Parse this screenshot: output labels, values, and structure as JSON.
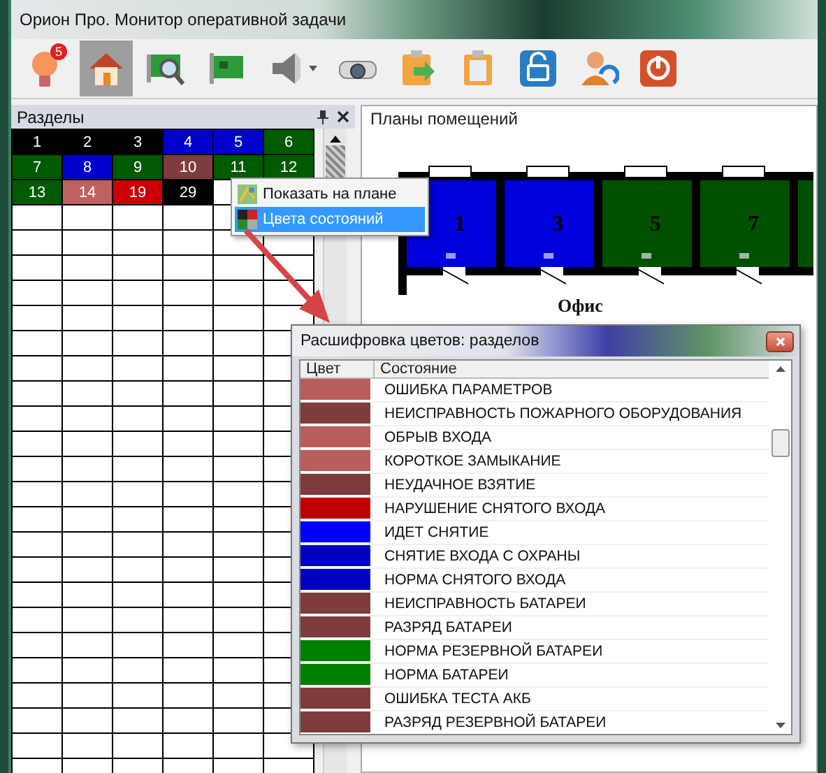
{
  "window": {
    "title": "Орион Про. Монитор оперативной задачи"
  },
  "toolbar": [
    {
      "selected": false,
      "dropdown": false,
      "badge": "5"
    },
    {
      "selected": true,
      "dropdown": false
    },
    {
      "selected": false,
      "dropdown": false
    },
    {
      "selected": false,
      "dropdown": false
    },
    {
      "selected": false,
      "dropdown": true
    },
    {
      "selected": false,
      "dropdown": false
    },
    {
      "selected": false,
      "dropdown": false
    },
    {
      "selected": false,
      "dropdown": false
    },
    {
      "selected": false,
      "dropdown": false
    },
    {
      "selected": false,
      "dropdown": false
    },
    {
      "selected": false,
      "dropdown": false
    }
  ],
  "sections_panel": {
    "title": "Разделы",
    "cells": [
      {
        "text": "1",
        "color": "#000000"
      },
      {
        "text": "2",
        "color": "#000000"
      },
      {
        "text": "3",
        "color": "#000000"
      },
      {
        "text": "4",
        "color": "#0000cc"
      },
      {
        "text": "5",
        "color": "#0000cc"
      },
      {
        "text": "6",
        "color": "#005a00"
      },
      {
        "text": "7",
        "color": "#005a00"
      },
      {
        "text": "8",
        "color": "#0000cc"
      },
      {
        "text": "9",
        "color": "#005a00"
      },
      {
        "text": "10",
        "color": "#7f3c3c"
      },
      {
        "text": "11",
        "color": "#005a00"
      },
      {
        "text": "12",
        "color": "#005a00"
      },
      {
        "text": "13",
        "color": "#005a00"
      },
      {
        "text": "14",
        "color": "#c06060"
      },
      {
        "text": "19",
        "color": "#cc0000"
      },
      {
        "text": "29",
        "color": "#000000"
      }
    ]
  },
  "context_menu": {
    "items": [
      {
        "label": "Показать на плане",
        "selected": false
      },
      {
        "label": "Цвета состояний",
        "selected": true
      }
    ]
  },
  "plan_panel": {
    "title": "Планы помещений",
    "rooms": [
      {
        "label": "1",
        "color": "#0000dd"
      },
      {
        "label": "3",
        "color": "#0000dd"
      },
      {
        "label": "5",
        "color": "#005000"
      },
      {
        "label": "7",
        "color": "#005000"
      },
      {
        "color": "#005000"
      }
    ],
    "area_label": "Офис"
  },
  "dialog": {
    "title": "Расшифровка цветов: разделов",
    "columns": [
      "Цвет",
      "Состояние"
    ],
    "rows": [
      {
        "color": "#b85c5c",
        "state": "ОШИБКА ПАРАМЕТРОВ"
      },
      {
        "color": "#7f3c3c",
        "state": "НЕИСПРАВНОСТЬ ПОЖАРНОГО ОБОРУДОВАНИЯ"
      },
      {
        "color": "#b85c5c",
        "state": "ОБРЫВ ВХОДА"
      },
      {
        "color": "#b85c5c",
        "state": "КОРОТКОЕ ЗАМЫКАНИЕ"
      },
      {
        "color": "#7f3c3c",
        "state": "НЕУДАЧНОЕ ВЗЯТИЕ"
      },
      {
        "color": "#c00000",
        "state": "НАРУШЕНИЕ СНЯТОГО ВХОДА"
      },
      {
        "color": "#0000ff",
        "state": "ИДЕТ СНЯТИЕ"
      },
      {
        "color": "#0000c0",
        "state": "СНЯТИЕ ВХОДА С ОХРАНЫ"
      },
      {
        "color": "#0000c0",
        "state": "НОРМА СНЯТОГО ВХОДА"
      },
      {
        "color": "#7f3c3c",
        "state": "НЕИСПРАВНОСТЬ БАТАРЕИ"
      },
      {
        "color": "#7f3c3c",
        "state": "РАЗРЯД БАТАРЕИ"
      },
      {
        "color": "#008000",
        "state": "НОРМА РЕЗЕРВНОЙ БАТАРЕИ"
      },
      {
        "color": "#008000",
        "state": "НОРМА БАТАРЕИ"
      },
      {
        "color": "#7f3c3c",
        "state": "ОШИБКА ТЕСТА АКБ"
      },
      {
        "color": "#7f3c3c",
        "state": "РАЗРЯД РЕЗЕРВНОЙ БАТАРЕИ"
      }
    ]
  }
}
